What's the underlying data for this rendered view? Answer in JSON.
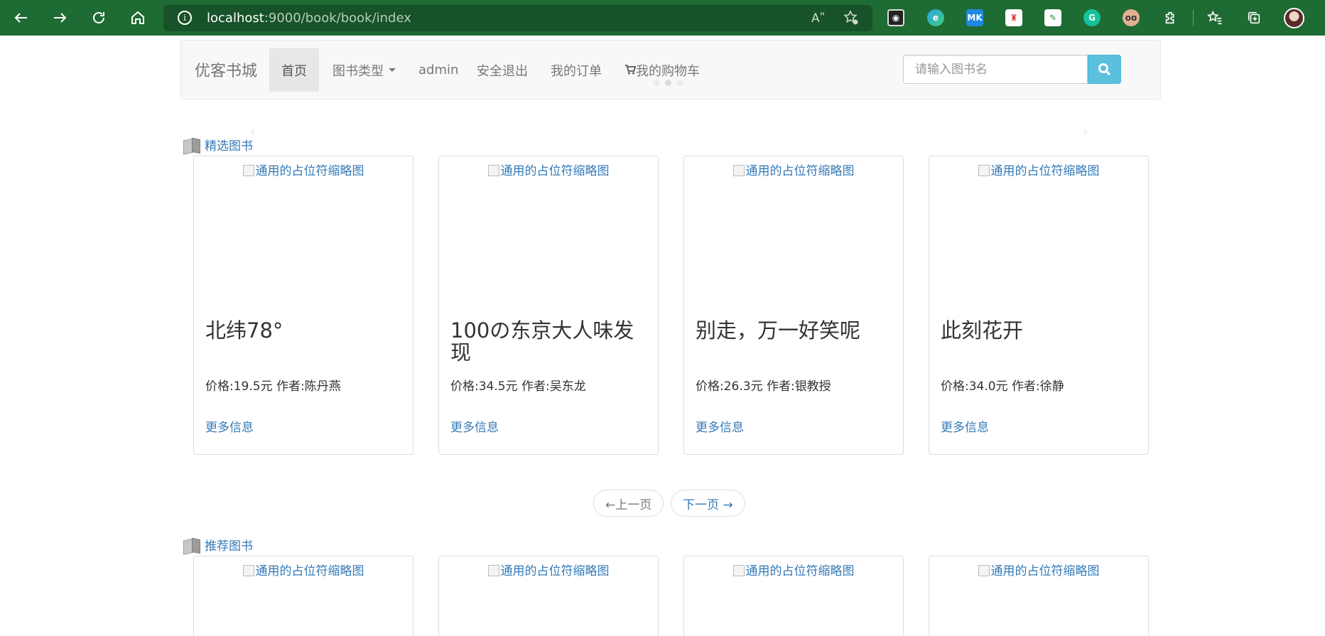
{
  "browser": {
    "url_host": "localhost",
    "url_rest": ":9000/book/book/index",
    "read_aloud": "Aʺ"
  },
  "site": {
    "brand": "优客书城",
    "nav": [
      {
        "label": "首页"
      },
      {
        "label": "图书类型"
      },
      {
        "label": "admin"
      },
      {
        "label": "安全退出"
      },
      {
        "label": "我的订单"
      },
      {
        "label": "我的购物车"
      }
    ],
    "search_placeholder": "请输入图书名"
  },
  "featured": {
    "title": "精选图书",
    "books": [
      {
        "thumb_alt": "通用的占位符缩略图",
        "title": "北纬78°",
        "meta": "价格:19.5元  作者:陈丹燕",
        "more": "更多信息"
      },
      {
        "thumb_alt": "通用的占位符缩略图",
        "title": "100の东京大人味发现",
        "meta": "价格:34.5元  作者:吴东龙",
        "more": "更多信息"
      },
      {
        "thumb_alt": "通用的占位符缩略图",
        "title": "别走，万一好笑呢",
        "meta": "价格:26.3元  作者:银教授",
        "more": "更多信息"
      },
      {
        "thumb_alt": "通用的占位符缩略图",
        "title": "此刻花开",
        "meta": "价格:34.0元  作者:徐静",
        "more": "更多信息"
      }
    ]
  },
  "pager": {
    "prev": "←上一页",
    "next": "下一页 →"
  },
  "recommended": {
    "title": "推荐图书",
    "books": [
      {
        "thumb_alt": "通用的占位符缩略图"
      },
      {
        "thumb_alt": "通用的占位符缩略图"
      },
      {
        "thumb_alt": "通用的占位符缩略图"
      },
      {
        "thumb_alt": "通用的占位符缩略图"
      }
    ]
  },
  "colors": {
    "browser_bar": "#1e6b33",
    "link": "#337ab7",
    "search_button": "#5bc0de"
  }
}
